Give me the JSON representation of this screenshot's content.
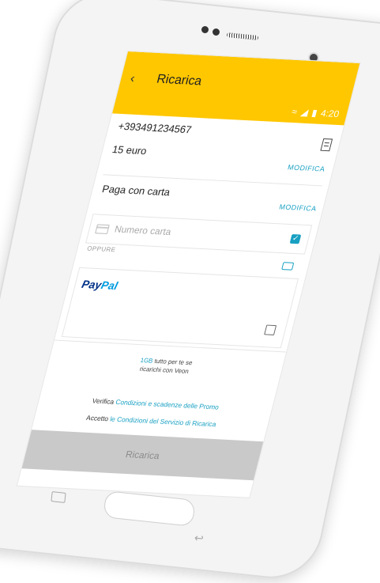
{
  "status_bar": {
    "time": "4:20"
  },
  "appbar": {
    "back_icon": "chevron-left-icon",
    "title": "Ricarica"
  },
  "recharge": {
    "phone_number": "+393491234567",
    "amount": "15 euro",
    "modify_amount": "MODIFICA"
  },
  "payment": {
    "pay_with_card": "Paga con carta",
    "modify_card": "MODIFICA",
    "card_number_placeholder": "Numero carta",
    "card_checkbox_checked": true,
    "or_label": "OPPURE",
    "paypal_label_a": "Pay",
    "paypal_label_b": "Pal",
    "paypal_checkbox_checked": false
  },
  "promo": {
    "gb": "1GB",
    "line1_rest": " tutto per te se",
    "line2": "ricarichi con Veon"
  },
  "terms": {
    "verify_prefix": "Verifica ",
    "verify_link": "Condizioni e scadenze delle Promo",
    "accept_prefix": "Accetto ",
    "accept_link": "le Condizioni del Servizio di Ricarica"
  },
  "button": {
    "label": "Ricarica"
  },
  "colors": {
    "accent": "#ffc700",
    "link": "#18a0c2",
    "disabled": "#c9c9c9"
  }
}
